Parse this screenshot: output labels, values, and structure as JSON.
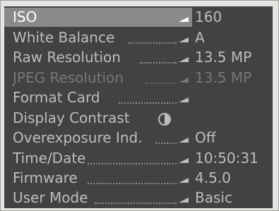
{
  "menu": {
    "items": [
      {
        "label": "ISO",
        "value": "160"
      },
      {
        "label": "White Balance",
        "value": "A"
      },
      {
        "label": "Raw Resolution",
        "value": "13.5 MP"
      },
      {
        "label": "JPEG Resolution",
        "value": "13.5 MP"
      },
      {
        "label": "Format Card",
        "value": ""
      },
      {
        "label": "Display Contrast",
        "value": ""
      },
      {
        "label": "Overexposure Ind.",
        "value": "Off"
      },
      {
        "label": "Time/Date",
        "value": "10:50:31"
      },
      {
        "label": "Firmware",
        "value": "4.5.0"
      },
      {
        "label": "User Mode",
        "value": "Basic"
      }
    ],
    "selected_index": 0,
    "disabled_index": 3,
    "icons": {
      "submenu_arrow": "submenu-arrow-icon",
      "contrast": "contrast-icon"
    }
  }
}
